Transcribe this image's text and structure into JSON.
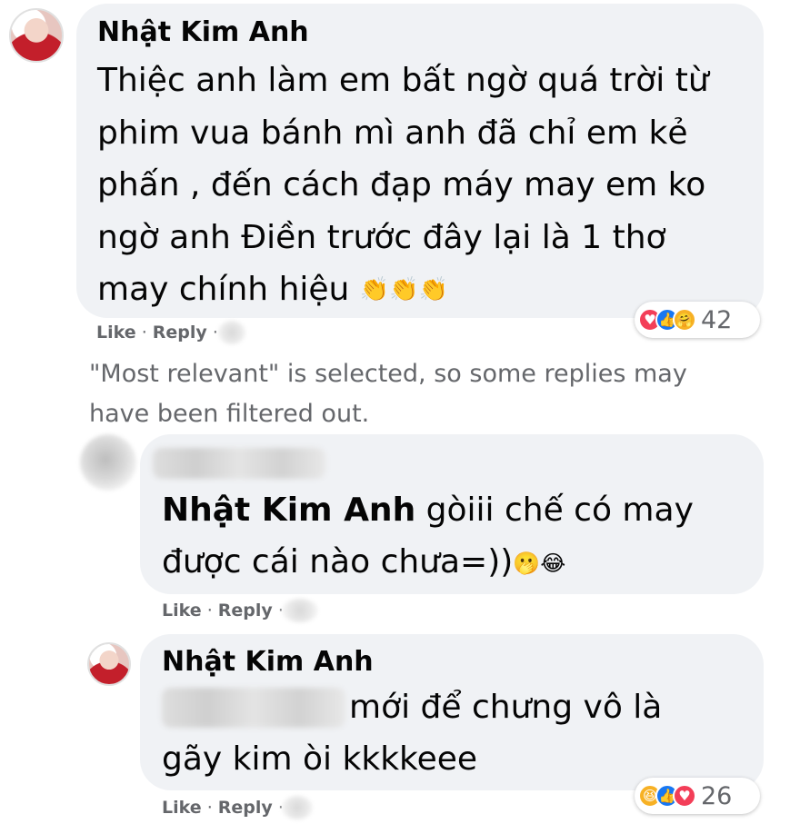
{
  "comment": {
    "author": "Nhật Kim Anh",
    "lines": [
      "Thiệc anh làm em bất ngờ quá trời từ",
      "phim vua bánh mì anh đã chỉ em kẻ",
      "phấn , đến cách đạp máy may em ko",
      "ngờ anh Điền trước đây lại là 1 thơ",
      "may chính hiệu"
    ],
    "emoji": "👏👏👏",
    "actions": {
      "like": "Like",
      "reply": "Reply"
    },
    "reactions": {
      "icons": [
        "love-icon",
        "like-icon",
        "care-icon"
      ],
      "count": "42"
    }
  },
  "notice": {
    "lines": [
      "\"Most relevant\" is selected, so some replies may",
      "have been filtered out."
    ]
  },
  "reply1": {
    "mention": "Nhật Kim Anh",
    "line1_rest": " gòiii chế có may",
    "line2": "được cái nào chưa=))",
    "emoji": "🫢😂",
    "actions": {
      "like": "Like",
      "reply": "Reply"
    }
  },
  "reply2": {
    "author": "Nhật Kim Anh",
    "line1_rest": "mới để chưng vô là",
    "line2": "gãy kim òi kkkkeee",
    "actions": {
      "like": "Like",
      "reply": "Reply"
    },
    "reactions": {
      "icons": [
        "haha-icon",
        "like-icon",
        "love-icon"
      ],
      "count": "26"
    }
  },
  "colors": {
    "bubble": "#f0f2f5",
    "meta": "#65676b",
    "text": "#050505",
    "like_blue": "#1877f2",
    "love_red": "#f33e58"
  }
}
